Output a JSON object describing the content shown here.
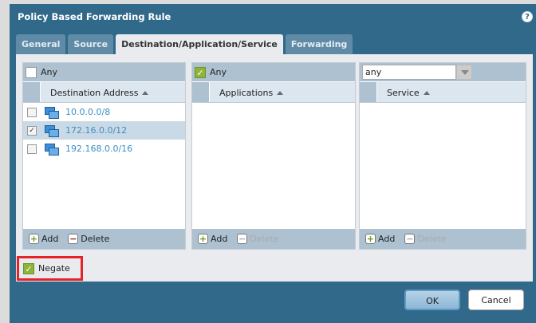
{
  "dialog": {
    "title": "Policy Based Forwarding Rule"
  },
  "tabs": [
    "General",
    "Source",
    "Destination/Application/Service",
    "Forwarding"
  ],
  "destination": {
    "any_label": "Any",
    "any_checked": false,
    "column": "Destination Address",
    "rows": [
      {
        "value": "10.0.0.0/8",
        "checked": false
      },
      {
        "value": "172.16.0.0/12",
        "checked": true
      },
      {
        "value": "192.168.0.0/16",
        "checked": false
      }
    ],
    "add": "Add",
    "delete": "Delete"
  },
  "applications": {
    "any_label": "Any",
    "any_checked": true,
    "column": "Applications",
    "add": "Add",
    "delete": "Delete"
  },
  "service": {
    "select_value": "any",
    "column": "Service",
    "add": "Add",
    "delete": "Delete"
  },
  "negate": {
    "label": "Negate",
    "checked": true
  },
  "buttons": {
    "ok": "OK",
    "cancel": "Cancel"
  }
}
